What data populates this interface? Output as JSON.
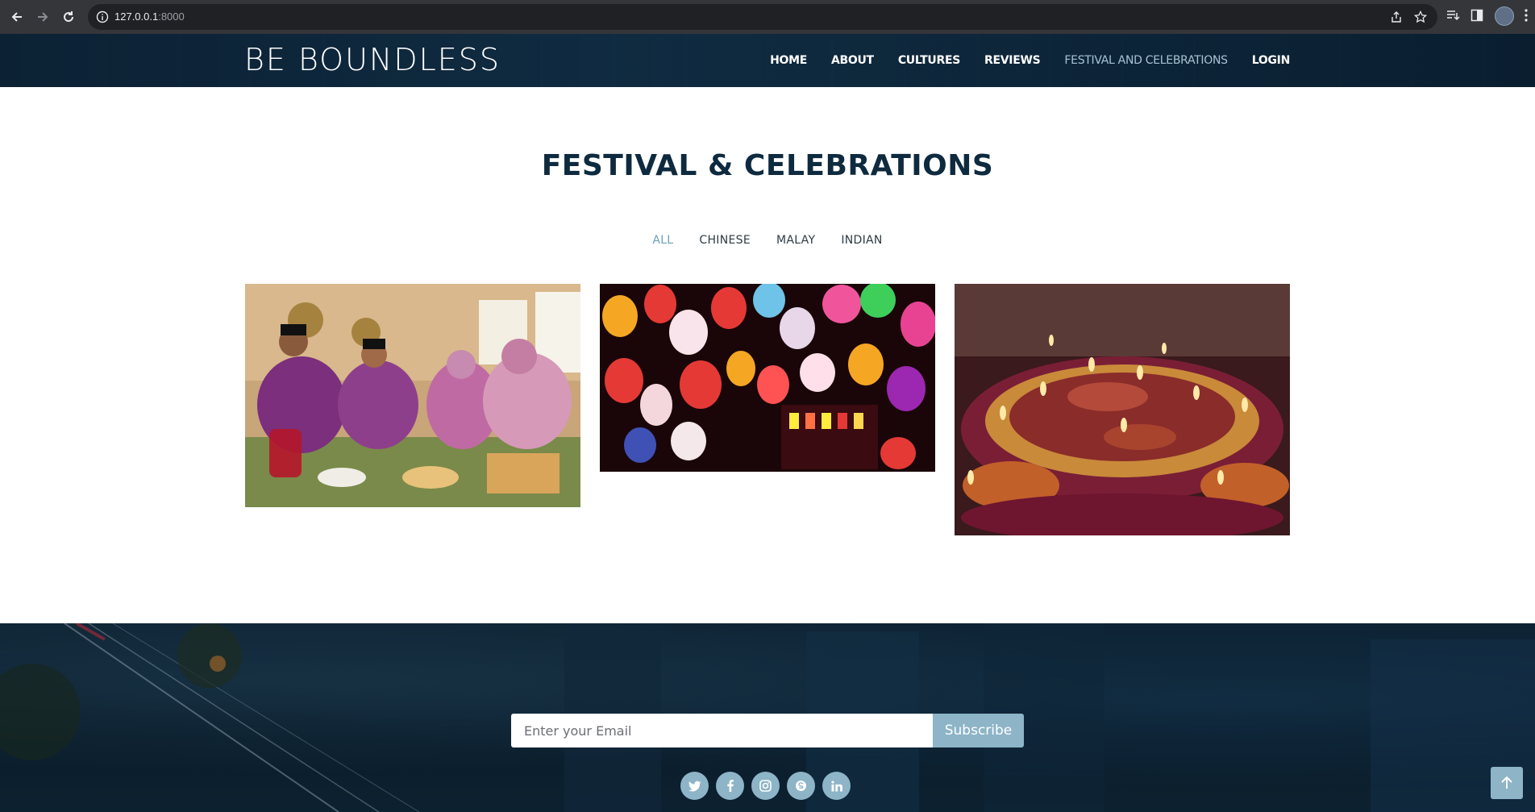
{
  "browser": {
    "url_host": "127.0.0.1",
    "url_port": ":8000"
  },
  "header": {
    "brand": "BE BOUNDLESS",
    "nav": [
      {
        "label": "HOME",
        "active": false
      },
      {
        "label": "ABOUT",
        "active": false
      },
      {
        "label": "CULTURES",
        "active": false
      },
      {
        "label": "REVIEWS",
        "active": false
      },
      {
        "label": "FESTIVAL AND CELEBRATIONS",
        "active": true
      },
      {
        "label": "LOGIN",
        "active": false
      }
    ]
  },
  "main": {
    "title": "FESTIVAL & CELEBRATIONS",
    "filters": [
      {
        "label": "ALL",
        "active": true
      },
      {
        "label": "CHINESE",
        "active": false
      },
      {
        "label": "MALAY",
        "active": false
      },
      {
        "label": "INDIAN",
        "active": false
      }
    ]
  },
  "footer": {
    "email_placeholder": "Enter your Email",
    "subscribe_label": "Subscribe",
    "social": [
      "twitter-icon",
      "facebook-icon",
      "instagram-icon",
      "skype-icon",
      "linkedin-icon"
    ]
  },
  "colors": {
    "accent": "#8db4c7",
    "title": "#0e2a3f",
    "active_nav": "#a9c2d3",
    "active_filter": "#6ea0bd"
  }
}
